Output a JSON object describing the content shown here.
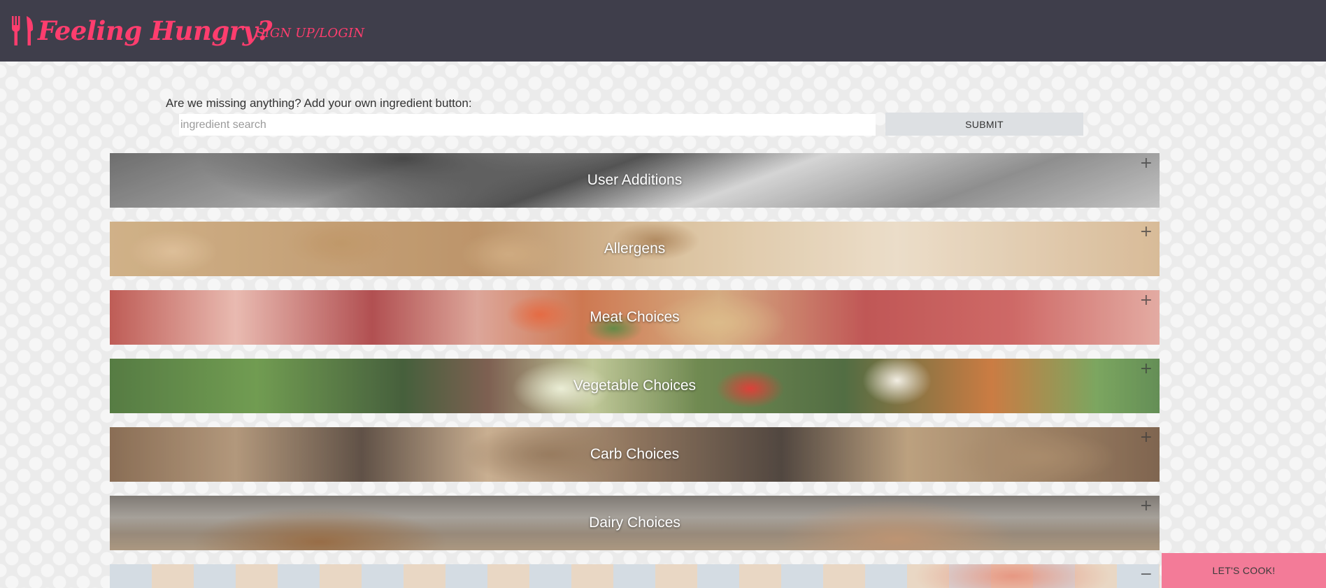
{
  "navbar": {
    "brand_text": "Feeling Hungry?",
    "brand_icon": "utensils-icon",
    "link_label": "SIGN UP/LOGIN",
    "background": "#3f3e4b",
    "accent": "#ff3d6e"
  },
  "add_form": {
    "label": "Are we missing anything? Add your own ingredient button:",
    "input_placeholder": "ingredient search",
    "input_value": "",
    "submit_label": "SUBMIT"
  },
  "categories": [
    {
      "title": "User Additions",
      "toggle": "+"
    },
    {
      "title": "Allergens",
      "toggle": "+"
    },
    {
      "title": "Meat Choices",
      "toggle": "+"
    },
    {
      "title": "Vegetable Choices",
      "toggle": "+"
    },
    {
      "title": "Carb Choices",
      "toggle": "+"
    },
    {
      "title": "Dairy Choices",
      "toggle": "+"
    },
    {
      "title": "",
      "toggle": "−"
    }
  ],
  "cta": {
    "label": "LET'S COOK!",
    "color": "#f37b98"
  }
}
